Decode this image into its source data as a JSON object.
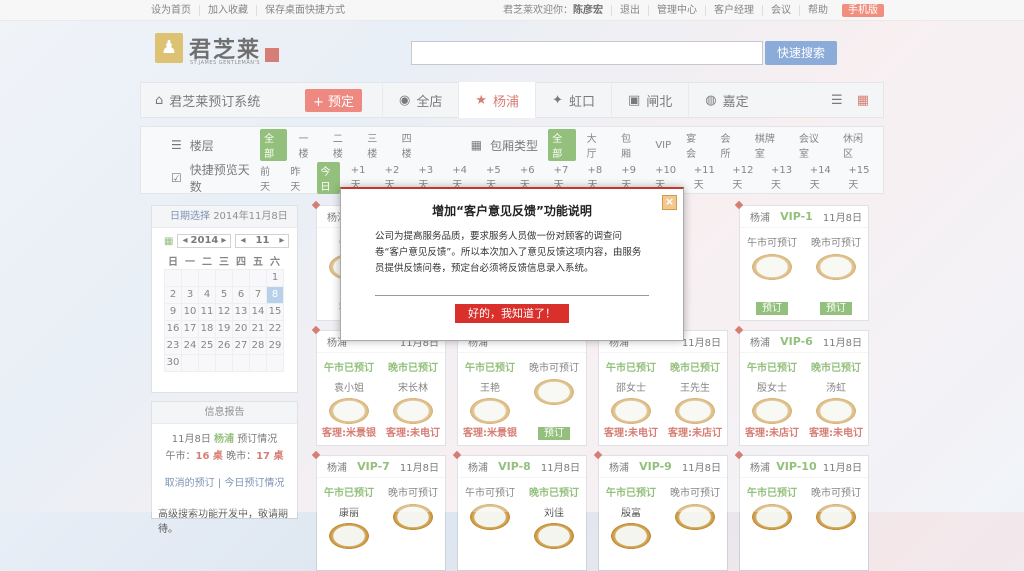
{
  "topbar": {
    "links": [
      "设为首页",
      "加入收藏",
      "保存桌面快捷方式"
    ],
    "welcome": "君芝莱欢迎你：",
    "user": "陈彦宏",
    "right_links": [
      "退出",
      "管理中心",
      "客户经理",
      "会议",
      "帮助"
    ],
    "mobile": "手机版"
  },
  "logo": {
    "name": "君芝莱",
    "sub": "ST.JAMES GENTLEMAN'S"
  },
  "search": {
    "placeholder": "",
    "button": "快速搜索"
  },
  "nav": {
    "system": "君芝莱预订系统",
    "reserve": "+ 预定",
    "tabs": [
      "全店",
      "杨浦",
      "虹口",
      "闸北",
      "嘉定"
    ],
    "active": "杨浦"
  },
  "filters": {
    "floor_label": "楼层",
    "floor_opts": [
      "全部",
      "一楼",
      "二楼",
      "三楼",
      "四楼"
    ],
    "type_label": "包厢类型",
    "type_opts": [
      "全部",
      "大厅",
      "包厢",
      "VIP",
      "宴会",
      "会所",
      "棋牌室",
      "会议室",
      "休闲区"
    ],
    "days_label": "快捷预览天数",
    "days_opts": [
      "前天",
      "昨天",
      "今日",
      "+1天",
      "+2天",
      "+3天",
      "+4天",
      "+5天",
      "+6天",
      "+7天",
      "+8天",
      "+9天",
      "+10天",
      "+11天",
      "+12天",
      "+13天",
      "+14天",
      "+15天"
    ]
  },
  "calendar": {
    "title": "日期选择",
    "date": "2014年11月8日",
    "year": "2014",
    "month": "11",
    "weekdays": [
      "日",
      "一",
      "二",
      "三",
      "四",
      "五",
      "六"
    ],
    "rows": [
      [
        "",
        "",
        "",
        "",
        "",
        "",
        "1"
      ],
      [
        "2",
        "3",
        "4",
        "5",
        "6",
        "7",
        "8"
      ],
      [
        "9",
        "10",
        "11",
        "12",
        "13",
        "14",
        "15"
      ],
      [
        "16",
        "17",
        "18",
        "19",
        "20",
        "21",
        "22"
      ],
      [
        "23",
        "24",
        "25",
        "26",
        "27",
        "28",
        "29"
      ],
      [
        "30",
        "",
        "",
        "",
        "",
        "",
        ""
      ]
    ],
    "today": "8"
  },
  "info": {
    "title": "信息报告",
    "line1a": "11月8日",
    "line1b": "杨浦",
    "line1c": "预订情况",
    "lunch_label": "午市：",
    "lunch_val": "16 桌",
    "dinner_label": "晚市：",
    "dinner_val": "17 桌",
    "link1": "取消的预订",
    "link2": "今日预订情况",
    "note": "高级搜索功能开发中，敬请期待。"
  },
  "cards": [
    {
      "loc": "杨浦",
      "room": "",
      "date": "",
      "l_status": "午市",
      "l_name": "",
      "l_act": "客理",
      "r_status": "",
      "r_name": "",
      "r_act": ""
    },
    {
      "loc": "杨浦",
      "room": "VIP-1",
      "date": "11月8日",
      "l_status": "午市可预订",
      "l_name": "",
      "l_act": "预订",
      "r_status": "晚市可预订",
      "r_name": "",
      "r_act": "预订"
    },
    {
      "loc": "杨浦",
      "room": "",
      "date": "11月8日",
      "l_status": "午市已预订",
      "l_name": "袁小姐",
      "l_act": "客理:米景银",
      "r_status": "晚市已预订",
      "r_name": "宋长林",
      "r_act": "客理:未电订"
    },
    {
      "loc": "杨浦",
      "room": "",
      "date": "",
      "l_status": "午市已预订",
      "l_name": "王艳",
      "l_act": "客理:米景银",
      "r_status": "晚市可预订",
      "r_name": "",
      "r_act": "预订"
    },
    {
      "loc": "杨浦",
      "room": "",
      "date": "11月8日",
      "l_status": "午市已预订",
      "l_name": "邵女士",
      "l_act": "客理:未电订",
      "r_status": "晚市已预订",
      "r_name": "王先生",
      "r_act": "客理:未店订"
    },
    {
      "loc": "杨浦",
      "room": "VIP-6",
      "date": "11月8日",
      "l_status": "午市已预订",
      "l_name": "殷女士",
      "l_act": "客理:未店订",
      "r_status": "晚市已预订",
      "r_name": "汤虹",
      "r_act": "客理:未电订"
    },
    {
      "loc": "杨浦",
      "room": "VIP-7",
      "date": "11月8日",
      "l_status": "午市已预订",
      "l_name": "康丽",
      "l_act": "",
      "r_status": "晚市可预订",
      "r_name": "",
      "r_act": ""
    },
    {
      "loc": "杨浦",
      "room": "VIP-8",
      "date": "11月8日",
      "l_status": "午市可预订",
      "l_name": "",
      "l_act": "",
      "r_status": "晚市已预订",
      "r_name": "刘佳",
      "r_act": ""
    },
    {
      "loc": "杨浦",
      "room": "VIP-9",
      "date": "11月8日",
      "l_status": "午市已预订",
      "l_name": "殷富",
      "l_act": "",
      "r_status": "晚市可预订",
      "r_name": "",
      "r_act": ""
    },
    {
      "loc": "杨浦",
      "room": "VIP-10",
      "date": "11月8日",
      "l_status": "午市已预订",
      "l_name": "",
      "l_act": "",
      "r_status": "晚市可预订",
      "r_name": "",
      "r_act": ""
    }
  ],
  "modal": {
    "title": "增加“客户意见反馈”功能说明",
    "body": "公司为提高服务品质，要求服务人员做一份对顾客的调查问卷“客户意见反馈”。所以本次加入了意见反馈这项内容，由服务员提供反馈问卷，预定台必须将反馈信息录入系统。",
    "ok": "好的，我知道了！",
    "close": "×"
  }
}
